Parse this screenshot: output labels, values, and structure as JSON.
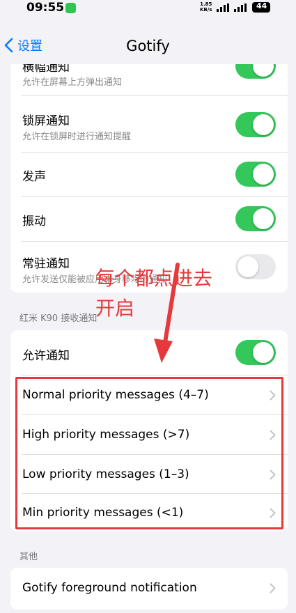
{
  "status": {
    "time": "09:55",
    "speed_value": "1.85",
    "speed_unit": "KB/s",
    "battery": "44"
  },
  "nav": {
    "back_label": "设置",
    "title": "Gotify"
  },
  "top_card": {
    "rows": [
      {
        "label": "横幅通知",
        "sub": "允许在屏幕上方弹出通知",
        "on": true
      },
      {
        "label": "锁屏通知",
        "sub": "允许在锁屏时进行通知提醒",
        "on": true
      },
      {
        "label": "发声",
        "on": true
      },
      {
        "label": "振动",
        "on": true
      },
      {
        "label": "常驻通知",
        "sub": "允许发送仅能被应用本身移除的通知",
        "on": false
      }
    ]
  },
  "device_section": {
    "header": "红米 K90 接收通知",
    "allow_label": "允许通知",
    "channels": [
      "Normal priority messages (4–7)",
      "High priority messages (>7)",
      "Low priority messages (1–3)",
      "Min priority messages (<1)"
    ]
  },
  "other_section": {
    "header": "其他",
    "item": "Gotify foreground notification"
  },
  "annotation": {
    "text": "每个都点进去开启",
    "color": "#e5393b"
  },
  "colors": {
    "accent": "#0a7cff",
    "toggle_on": "#34c759",
    "annotation": "#e5393b"
  }
}
